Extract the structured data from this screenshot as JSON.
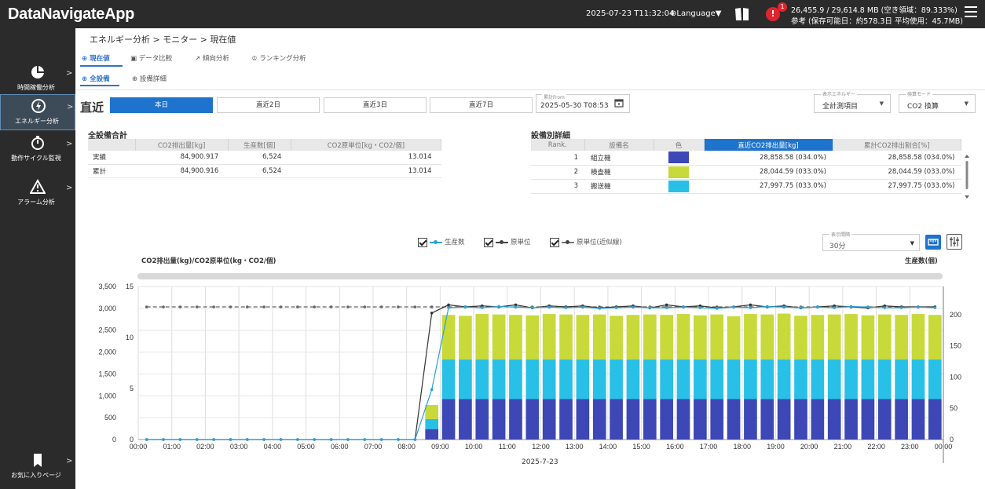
{
  "app": {
    "title": "DataNavigateApp",
    "datetime": "2025-07-23 T11:32:04",
    "language": "Language▼",
    "alert_count": "1",
    "alert_mark": "!",
    "memory_line1": "26,455.9 / 29,614.8 MB (空き領域：89.333%)",
    "memory_line2": "参考 (保存可能日：約578.3日 平均使用：45.7MB)"
  },
  "sidebar": {
    "items": [
      {
        "label": "時間稼働分析",
        "icon": "pie-chart-icon"
      },
      {
        "label": "エネルギー分析",
        "icon": "lightning-icon"
      },
      {
        "label": "動作サイクル監視",
        "icon": "stopwatch-icon"
      },
      {
        "label": "アラーム分析",
        "icon": "warning-icon"
      },
      {
        "label": "お気に入りページ",
        "icon": "bookmark-icon"
      }
    ],
    "arrow": ">"
  },
  "breadcrumb": "エネルギー分析 > モニター > 現在値",
  "tabs": [
    "現在値",
    "データ比較",
    "傾向分析",
    "ランキング分析"
  ],
  "subtabs": [
    "全設備",
    "設備詳細"
  ],
  "period": {
    "label": "直近",
    "buttons": [
      "本日",
      "直近2日",
      "直近3日",
      "直近7日"
    ]
  },
  "from": {
    "label": "累計From",
    "value": "2025-05-30 T08:53"
  },
  "energy_select": {
    "label": "表示エネルギー",
    "value": "全計測項目",
    "arrow": "▼"
  },
  "mode_select": {
    "label": "換算モード",
    "value": "CO2 換算",
    "arrow": "▼"
  },
  "summary": {
    "title": "全設備合計",
    "headers": [
      "",
      "CO2排出量[kg]",
      "生産数[個]",
      "CO2原単位[kg・CO2/個]"
    ],
    "rows": [
      [
        "実績",
        "84,900.917",
        "6,524",
        "13.014"
      ],
      [
        "累計",
        "84,900.916",
        "6,524",
        "13.014"
      ]
    ]
  },
  "detail": {
    "title": "設備別詳細",
    "headers": [
      "Rank.",
      "設備名",
      "色",
      "直近CO2排出量[kg]",
      "累計CO2排出割合[%]"
    ],
    "rows": [
      {
        "rank": "1",
        "name": "組立機",
        "color": "#3d47b5",
        "recent": "28,858.58 (034.0%)",
        "total": "28,858.58 (034.0%)"
      },
      {
        "rank": "2",
        "name": "検査機",
        "color": "#c8d93a",
        "recent": "28,044.59 (033.0%)",
        "total": "28,044.59 (033.0%)"
      },
      {
        "rank": "3",
        "name": "搬送機",
        "color": "#28c0e6",
        "recent": "27,997.75 (033.0%)",
        "total": "27,997.75 (033.0%)"
      }
    ]
  },
  "legend": [
    {
      "label": "生産数",
      "color": "#2aa2d8"
    },
    {
      "label": "原単位",
      "color": "#444444"
    },
    {
      "label": "原単位(近似線)",
      "color": "#444444"
    }
  ],
  "interval": {
    "label": "表示間隔",
    "value": "30分",
    "arrow": "▼"
  },
  "chart_data": {
    "type": "bar",
    "title": "",
    "ylabel_left": "CO2排出量(kg)/CO2原単位(kg・CO2/個)",
    "ylabel_right": "生産数(個)",
    "xlabel": "2025-7-23",
    "x_ticks": [
      "00:00",
      "01:00",
      "02:00",
      "03:00",
      "04:00",
      "05:00",
      "06:00",
      "07:00",
      "08:00",
      "09:00",
      "10:00",
      "11:00",
      "12:00",
      "13:00",
      "14:00",
      "15:00",
      "16:00",
      "17:00",
      "18:00",
      "19:00",
      "20:00",
      "21:00",
      "22:00",
      "23:00",
      "00:00"
    ],
    "y_left_ticks": [
      "0",
      "500",
      "1,000",
      "1,500",
      "2,000",
      "2,500",
      "3,000",
      "3,500"
    ],
    "y_left_range": [
      0,
      3500
    ],
    "y_unit_ticks": [
      "0",
      "5",
      "10",
      "15"
    ],
    "y_unit_range": [
      0,
      15
    ],
    "y_right_ticks": [
      "0",
      "50",
      "100",
      "150",
      "200"
    ],
    "y_right_range": [
      0,
      245
    ],
    "n_slots": 48,
    "bar_start_slot": 17,
    "series": [
      {
        "name": "組立機",
        "color": "#3d47b5",
        "values": [
          240,
          930,
          930,
          930,
          930,
          930,
          930,
          930,
          930,
          930,
          930,
          930,
          930,
          930,
          930,
          930,
          930,
          930,
          930,
          930,
          930,
          930,
          930,
          930,
          930,
          930,
          930,
          930,
          930,
          930,
          930
        ]
      },
      {
        "name": "検査機",
        "color": "#28c0e6",
        "values": [
          230,
          900,
          900,
          900,
          900,
          900,
          900,
          900,
          900,
          900,
          900,
          900,
          900,
          900,
          900,
          900,
          900,
          900,
          900,
          900,
          900,
          900,
          900,
          900,
          900,
          900,
          900,
          900,
          900,
          900,
          900
        ]
      },
      {
        "name": "搬送機",
        "color": "#c8d93a",
        "values": [
          320,
          1020,
          1000,
          1040,
          1030,
          1020,
          1010,
          1040,
          1030,
          1020,
          1030,
          1000,
          1020,
          1030,
          1020,
          1040,
          1010,
          1030,
          990,
          1040,
          1030,
          1050,
          1000,
          1020,
          1030,
          1040,
          1010,
          1030,
          1020,
          1040,
          1020
        ]
      }
    ],
    "line_series": [
      {
        "name": "生産数",
        "color": "#2aa2d8",
        "values": [
          0,
          0,
          0,
          0,
          0,
          0,
          0,
          0,
          0,
          0,
          0,
          0,
          0,
          0,
          0,
          0,
          0,
          80,
          211,
          212,
          211,
          213,
          212,
          211,
          212,
          211,
          212,
          210,
          211,
          212,
          211,
          211,
          212,
          211,
          210,
          212,
          211,
          213,
          212,
          211,
          212,
          211,
          213,
          212,
          211,
          211,
          212,
          211
        ]
      },
      {
        "name": "原単位",
        "color": "#333333",
        "values": [
          0,
          0,
          0,
          0,
          0,
          0,
          0,
          0,
          0,
          0,
          0,
          0,
          0,
          0,
          0,
          0,
          0,
          12.4,
          13.2,
          13.0,
          13.1,
          13.0,
          13.2,
          12.9,
          13.1,
          13.0,
          13.1,
          12.9,
          13.0,
          13.1,
          12.9,
          13.2,
          13.0,
          13.1,
          12.9,
          13.0,
          13.2,
          13.0,
          13.1,
          12.9,
          13.0,
          13.1,
          13.0,
          12.9,
          13.1,
          13.0,
          13.0,
          13.0
        ]
      },
      {
        "name": "原単位(近似線)",
        "color": "#666666",
        "values": [
          13.0,
          13.0,
          13.0,
          13.0,
          13.0,
          13.0,
          13.0,
          13.0,
          13.0,
          13.0,
          13.0,
          13.0,
          13.0,
          13.0,
          13.0,
          13.0,
          13.0,
          13.0,
          13.0,
          13.0,
          13.0,
          13.0,
          13.0,
          13.0,
          13.0,
          13.0,
          13.0,
          13.0,
          13.0,
          13.0,
          13.0,
          13.0,
          13.0,
          13.0,
          13.0,
          13.0,
          13.0,
          13.0,
          13.0,
          13.0,
          13.0,
          13.0,
          13.0,
          13.0,
          13.0,
          13.0,
          13.0,
          13.0
        ]
      }
    ],
    "grid": true,
    "legend_position": "top"
  }
}
